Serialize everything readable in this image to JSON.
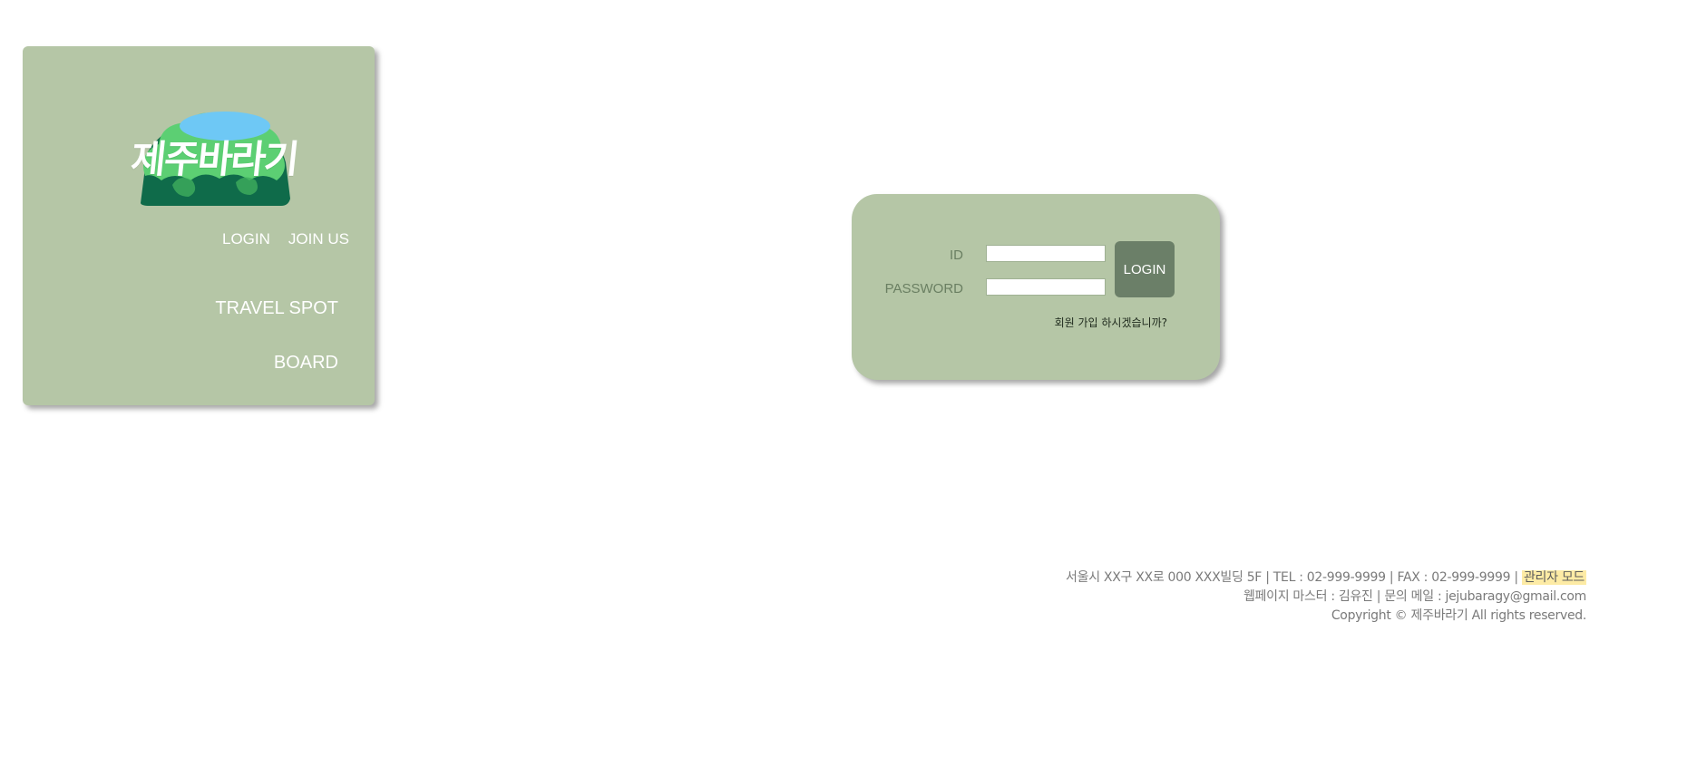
{
  "sidebar": {
    "logo_text": "제주바라기",
    "auth": {
      "login": "LOGIN",
      "join": "JOIN US"
    },
    "nav": {
      "travel": "TRAVEL SPOT",
      "board": "BOARD"
    }
  },
  "login_form": {
    "id_label": "ID",
    "id_value": "",
    "password_label": "PASSWORD",
    "password_value": "",
    "submit_label": "LOGIN",
    "signup_prompt": "회원 가입 하시겠습니까?"
  },
  "footer": {
    "address": "서울시 XX구 XX로 000 XXX빌딩 5F | TEL : 02-999-9999 | FAX : 02-999-9999 |",
    "admin_mode": "관리자 모드",
    "contact": "웹페이지 마스터 : 김유진 | 문의 메일 : jejubaragy@gmail.com",
    "copyright": "Copyright © 제주바라기 All rights reserved."
  },
  "colors": {
    "card_bg": "#b5c6a6",
    "button_bg": "#6b7f68",
    "admin_highlight": "#fdeba5",
    "logo_dark_green": "#0f6b4a",
    "logo_light_green": "#5ccf73",
    "logo_lake": "#6ec8f5"
  },
  "icons": {
    "logo": "jeju-mountain-logo"
  }
}
